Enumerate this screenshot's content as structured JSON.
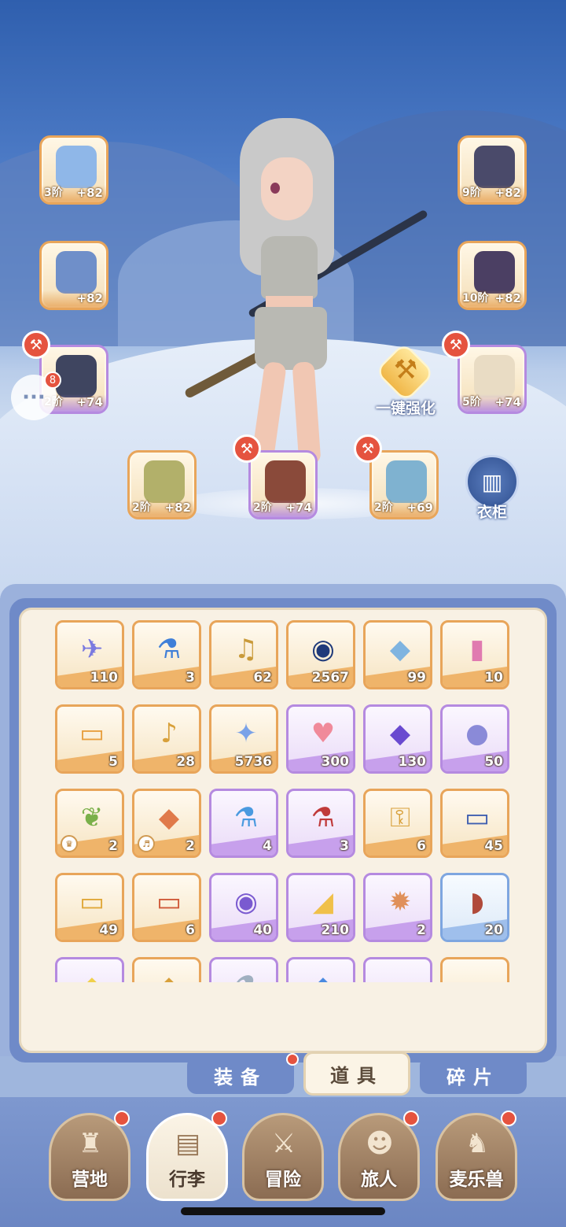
{
  "equipment": [
    {
      "id": "weapon",
      "tier": "3阶",
      "bonus": "+82",
      "rarity": "orange",
      "hammer": false,
      "icon": "axe-icon",
      "color": "#8fb7e8"
    },
    {
      "id": "helmet",
      "tier": "9阶",
      "bonus": "+82",
      "rarity": "orange",
      "hammer": false,
      "icon": "helmet-icon",
      "color": "#4a4a6a"
    },
    {
      "id": "armor",
      "tier": "",
      "bonus": "+82",
      "rarity": "orange",
      "hammer": false,
      "icon": "armor-icon",
      "color": "#6f8fc9"
    },
    {
      "id": "gloves",
      "tier": "10阶",
      "bonus": "+82",
      "rarity": "orange",
      "hammer": false,
      "icon": "gloves-icon",
      "color": "#4b3f63"
    },
    {
      "id": "pants",
      "tier": "2阶",
      "bonus": "+74",
      "rarity": "purple",
      "hammer": true,
      "icon": "pants-icon",
      "color": "#3f4560"
    },
    {
      "id": "boots",
      "tier": "5阶",
      "bonus": "+74",
      "rarity": "purple",
      "hammer": true,
      "icon": "boots-icon",
      "color": "#e9dcc4"
    },
    {
      "id": "ring",
      "tier": "2阶",
      "bonus": "+82",
      "rarity": "orange",
      "hammer": false,
      "icon": "ring-icon",
      "color": "#b2b06a"
    },
    {
      "id": "necklace",
      "tier": "2阶",
      "bonus": "+74",
      "rarity": "purple",
      "hammer": true,
      "icon": "necklace-icon",
      "color": "#8a4a3a"
    },
    {
      "id": "amulet",
      "tier": "2阶",
      "bonus": "+69",
      "rarity": "orange",
      "hammer": true,
      "icon": "amulet-icon",
      "color": "#7fb2d0"
    }
  ],
  "chat": {
    "badge": "8"
  },
  "enhance": {
    "label": "一键强化"
  },
  "wardrobe": {
    "label": "衣柜"
  },
  "items": [
    {
      "count": "110",
      "rarity": "orange",
      "icon": "paper-plane-icon",
      "glyph": "✈",
      "color": "#7a7ae0"
    },
    {
      "count": "3",
      "rarity": "orange",
      "icon": "blue-potion-icon",
      "glyph": "⚗",
      "color": "#3f7fd8"
    },
    {
      "count": "62",
      "rarity": "orange",
      "icon": "lyre-icon",
      "glyph": "♫",
      "color": "#c99a3a"
    },
    {
      "count": "2567",
      "rarity": "orange",
      "icon": "gem-orb-icon",
      "glyph": "◉",
      "color": "#1f3a7a"
    },
    {
      "count": "99",
      "rarity": "orange",
      "icon": "crystal-icon",
      "glyph": "◆",
      "color": "#7fb4e0"
    },
    {
      "count": "10",
      "rarity": "orange",
      "icon": "rainbow-bottle-icon",
      "glyph": "▮",
      "color": "#e07ab0"
    },
    {
      "count": "5",
      "rarity": "orange",
      "icon": "card-icon",
      "glyph": "▭",
      "color": "#e8a040"
    },
    {
      "count": "28",
      "rarity": "orange",
      "icon": "bell-icon",
      "glyph": "♪",
      "color": "#d8a03a"
    },
    {
      "count": "5736",
      "rarity": "orange",
      "icon": "star-crystal-icon",
      "glyph": "✦",
      "color": "#7aa2e8"
    },
    {
      "count": "300",
      "rarity": "purple",
      "icon": "heart-icon",
      "glyph": "♥",
      "color": "#f08a9a"
    },
    {
      "count": "130",
      "rarity": "purple",
      "icon": "purple-gem-icon",
      "glyph": "◆",
      "color": "#6a4ad0"
    },
    {
      "count": "50",
      "rarity": "purple",
      "icon": "coin-icon",
      "glyph": "●",
      "color": "#8a8ad8"
    },
    {
      "count": "2",
      "rarity": "orange",
      "icon": "leaf-crystal-icon",
      "glyph": "❦",
      "color": "#7ab04a",
      "mini": "♛"
    },
    {
      "count": "2",
      "rarity": "orange",
      "icon": "fire-crystal-icon",
      "glyph": "◆",
      "color": "#e07a4a",
      "mini": "♬"
    },
    {
      "count": "4",
      "rarity": "purple",
      "icon": "blue-flask-icon",
      "glyph": "⚗",
      "color": "#4a9ae0"
    },
    {
      "count": "3",
      "rarity": "purple",
      "icon": "red-flask-icon",
      "glyph": "⚗",
      "color": "#c03a3a"
    },
    {
      "count": "6",
      "rarity": "orange",
      "icon": "key-icon",
      "glyph": "⚿",
      "color": "#d8a03a"
    },
    {
      "count": "45",
      "rarity": "orange",
      "icon": "blue-card-icon",
      "glyph": "▭",
      "color": "#3f5fb0"
    },
    {
      "count": "49",
      "rarity": "orange",
      "icon": "gold-card-icon",
      "glyph": "▭",
      "color": "#e0a83a"
    },
    {
      "count": "6",
      "rarity": "orange",
      "icon": "red-card-icon",
      "glyph": "▭",
      "color": "#d05a3a"
    },
    {
      "count": "40",
      "rarity": "purple",
      "icon": "cat-mirror-icon",
      "glyph": "◉",
      "color": "#7a5ad0"
    },
    {
      "count": "210",
      "rarity": "purple",
      "icon": "cheese-icon",
      "glyph": "◢",
      "color": "#f0c04a"
    },
    {
      "count": "2",
      "rarity": "purple",
      "icon": "fox-badge-icon",
      "glyph": "✹",
      "color": "#e0905a"
    },
    {
      "count": "20",
      "rarity": "blue",
      "icon": "meat-icon",
      "glyph": "◗",
      "color": "#b04a3a"
    },
    {
      "count": "",
      "rarity": "purple",
      "icon": "yellow-item-icon",
      "glyph": "◆",
      "color": "#f0d04a"
    },
    {
      "count": "",
      "rarity": "orange",
      "icon": "gold-item-icon",
      "glyph": "◆",
      "color": "#d8a03a"
    },
    {
      "count": "",
      "rarity": "purple",
      "icon": "bottle-item-icon",
      "glyph": "⚗",
      "color": "#a0b0c0"
    },
    {
      "count": "",
      "rarity": "purple",
      "icon": "blue-item-icon",
      "glyph": "◆",
      "color": "#4a8ae0"
    },
    {
      "count": "",
      "rarity": "purple",
      "icon": "scroll-item-icon",
      "glyph": "▭",
      "color": "#c0a0a0"
    },
    {
      "count": "",
      "rarity": "orange",
      "icon": "book-item-icon",
      "glyph": "▭",
      "color": "#b07a4a"
    }
  ],
  "tabs": [
    {
      "label": "装备",
      "dot": true
    },
    {
      "label": "道具",
      "dot": false,
      "active": true
    },
    {
      "label": "碎片",
      "dot": false
    }
  ],
  "nav": [
    {
      "label": "营地",
      "icon": "castle-icon",
      "glyph": "♜",
      "dot": true
    },
    {
      "label": "行李",
      "icon": "backpack-icon",
      "glyph": "▤",
      "dot": true,
      "active": true
    },
    {
      "label": "冒险",
      "icon": "crossed-swords-icon",
      "glyph": "⚔",
      "dot": false
    },
    {
      "label": "旅人",
      "icon": "traveler-icon",
      "glyph": "☻",
      "dot": true
    },
    {
      "label": "麦乐兽",
      "icon": "beast-icon",
      "glyph": "♞",
      "dot": true
    }
  ]
}
